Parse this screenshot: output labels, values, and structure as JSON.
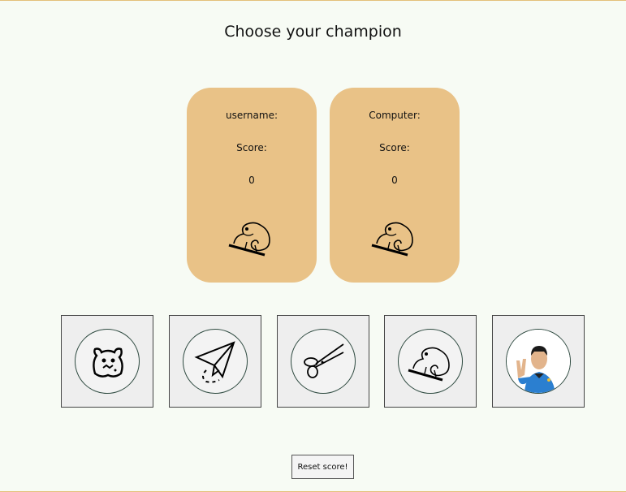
{
  "header": {
    "title": "Choose your champion"
  },
  "player_card": {
    "name_label": "username:",
    "score_label": "Score:",
    "score_value": "0",
    "current_choice_icon": "chameleon-icon"
  },
  "computer_card": {
    "name_label": "Computer:",
    "score_label": "Score:",
    "score_value": "0",
    "current_choice_icon": "chameleon-icon"
  },
  "choices": [
    {
      "icon": "rock-monster-icon"
    },
    {
      "icon": "paper-plane-icon"
    },
    {
      "icon": "scissors-icon"
    },
    {
      "icon": "lizard-chameleon-icon"
    },
    {
      "icon": "spock-icon"
    }
  ],
  "controls": {
    "reset_label": "Reset score!"
  },
  "colors": {
    "card_bg": "#e9c287",
    "page_bg": "#f7fbf4",
    "border_accent": "#e4c07a"
  }
}
